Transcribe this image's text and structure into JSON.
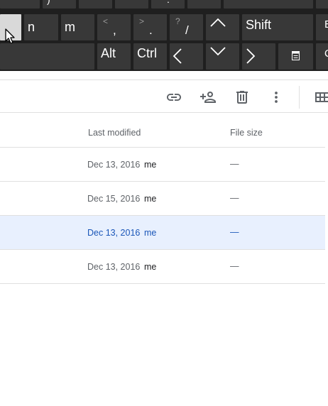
{
  "keyboard": {
    "top_row_partial": [
      ")",
      "",
      "",
      ":",
      ""
    ],
    "keys": {
      "n": "n",
      "m": "m",
      "comma_shift": "<",
      "comma": ",",
      "period_shift": ">",
      "period": ".",
      "slash_shift": "?",
      "slash": "/",
      "shift": "Shift",
      "alt": "Alt",
      "ctrl": "Ctrl"
    },
    "right_edge_glyph": "Q"
  },
  "toolbar": {
    "icons": [
      "link-icon",
      "add-person-icon",
      "trash-icon",
      "more-vert-icon",
      "grid-view-icon"
    ]
  },
  "columns": {
    "last_modified": "Last modified",
    "file_size": "File size"
  },
  "rows": [
    {
      "date": "Dec 13, 2016",
      "owner": "me",
      "size": "—",
      "selected": false
    },
    {
      "date": "Dec 15, 2016",
      "owner": "me",
      "size": "—",
      "selected": false
    },
    {
      "date": "Dec 13, 2016",
      "owner": "me",
      "size": "—",
      "selected": true
    },
    {
      "date": "Dec 13, 2016",
      "owner": "me",
      "size": "—",
      "selected": false
    }
  ],
  "colors": {
    "keyboard_bg": "#1f1f1f",
    "key_bg": "#383838",
    "selected_row_bg": "#e8f0fe",
    "selected_text": "#1a56b8",
    "divider": "#e0e0e0"
  }
}
